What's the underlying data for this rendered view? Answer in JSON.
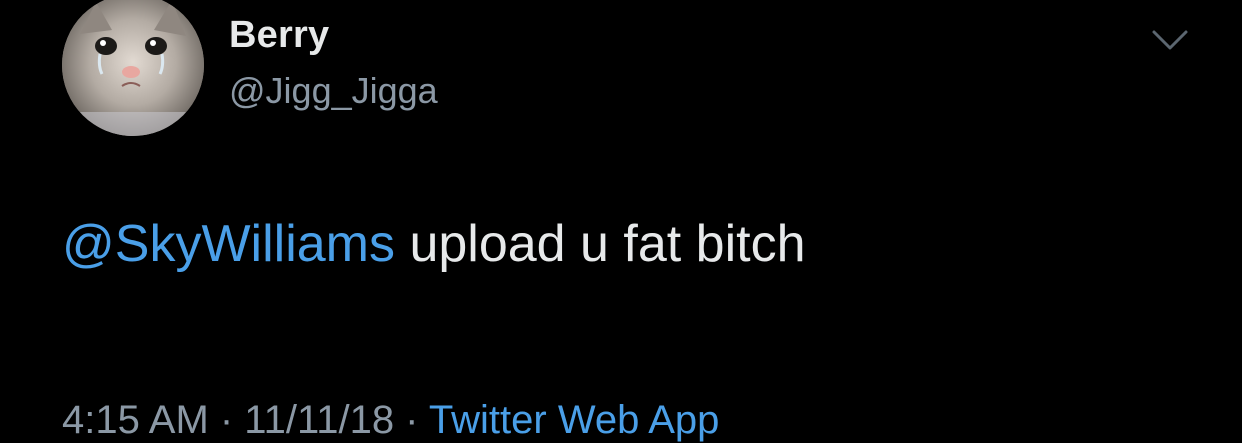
{
  "tweet": {
    "display_name": "Berry",
    "handle": "@Jigg_Jigga",
    "mention": "@SkyWilliams",
    "body": " upload u fat bitch",
    "timestamp": "4:15 AM · 11/11/18 · ",
    "source": "Twitter Web App",
    "menu_icon": "chevron-down-icon",
    "colors": {
      "background": "#000000",
      "link": "#4a9fe8",
      "text": "#e7e9ea",
      "secondary": "#8b98a5"
    }
  }
}
